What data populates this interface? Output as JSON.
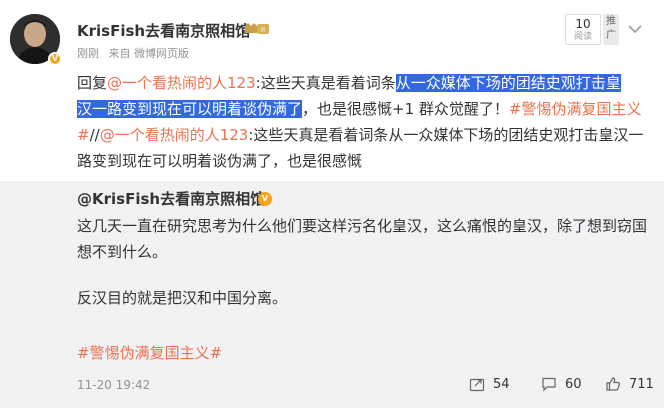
{
  "post": {
    "username": "KrisFish去看南京照相馆",
    "member_badge": "II",
    "time": "刚刚",
    "source": "来自 微博网页版",
    "read_count": "10",
    "read_label": "阅读",
    "promote_label": "推广",
    "text": {
      "reply_prefix": "回复",
      "mention1": "@一个看热闹的人123",
      "seg1": ":这些天真是看着词条",
      "hl1": "从一众媒体下场的团结史观打击皇",
      "hl2": "汉一路变到现在可以明着谈伪满了",
      "seg2": "，也是很感慨+1 群众觉醒了！",
      "hashtag1": "#警惕伪满复国主义#",
      "seg3": "//",
      "mention2": "@一个看热闹的人123",
      "seg4": ":这些天真是看着词条从一众媒体下场的团结史观打击皇汉一路变到现在可以明着谈伪满了，也是很感慨"
    }
  },
  "repost": {
    "author": "@KrisFish去看南京照相馆",
    "para1": "这几天一直在研究思考为什么他们要这样污名化皇汉，这么痛恨的皇汉，除了想到窃国想不到什么。",
    "para2": "反汉目的就是把汉和中国分离。",
    "hashtag": "#警惕伪满复国主义#",
    "time": "11-20 19:42",
    "reposts": "54",
    "comments": "60",
    "likes": "711"
  },
  "colors": {
    "accent": "#eb7350",
    "highlight": "#3468e0",
    "repost_bg": "#f2f2f5",
    "muted": "#939393"
  }
}
